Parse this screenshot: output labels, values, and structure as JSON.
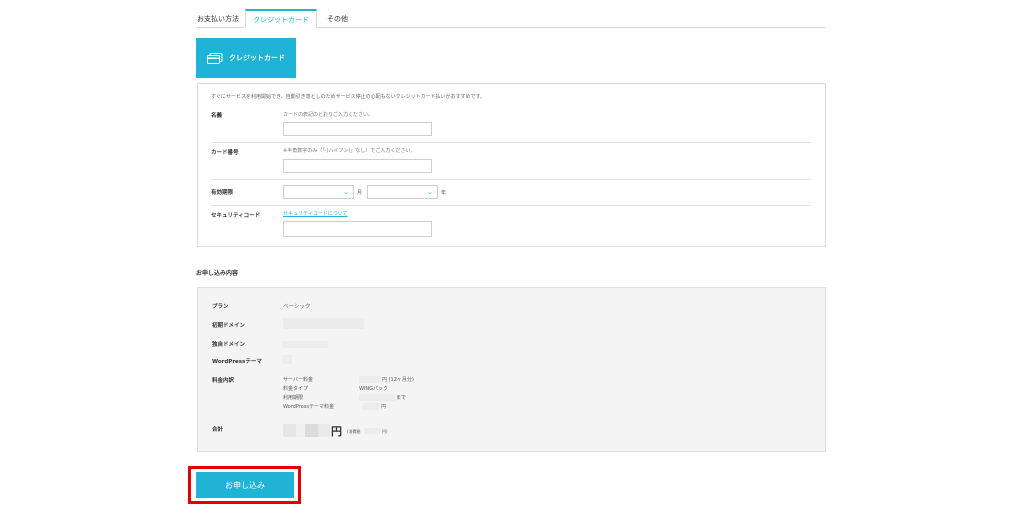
{
  "tabs": [
    {
      "label": "お支払い方法"
    },
    {
      "label": "クレジットカード"
    },
    {
      "label": "その他"
    }
  ],
  "method": {
    "label": "クレジットカード",
    "icon": "credit-card-icon"
  },
  "form": {
    "intro": "すぐにサービスを利用開始でき、自動引き落としのためサービス停止の心配もないクレジットカード払いがおすすめです。",
    "name_label": "名義",
    "name_hint": "カードの表記のとおりご入力ください。",
    "number_label": "カード番号",
    "number_hint": "※半角数字のみ（「-(ハイフン)」なし）でご入力ください。",
    "expiry_label": "有効期限",
    "month_unit": "月",
    "year_unit": "年",
    "cvc_label": "セキュリティコード",
    "cvc_link": "セキュリティコードについて"
  },
  "summary": {
    "title": "お申し込み内容",
    "plan_label": "プラン",
    "plan_value": "ベーシック",
    "initial_domain_label": "初期ドメイン",
    "own_domain_label": "独自ドメイン",
    "wp_theme_label": "WordPressテーマ",
    "fee_label": "料金内訳",
    "fee_rows": [
      {
        "name": "サーバー料金",
        "value": "円 (12ヶ月分)"
      },
      {
        "name": "料金タイプ",
        "value": "WINGパック"
      },
      {
        "name": "利用期限",
        "value": "まで"
      },
      {
        "name": "WordPressテーマ料金",
        "value": "円"
      }
    ],
    "total_label": "合計",
    "total_unit": "円",
    "tax_prefix": "(消費税",
    "tax_suffix": "円)"
  },
  "submit_label": "お申し込み",
  "colors": {
    "accent": "#1fb3d6",
    "highlight": "#e10000"
  }
}
